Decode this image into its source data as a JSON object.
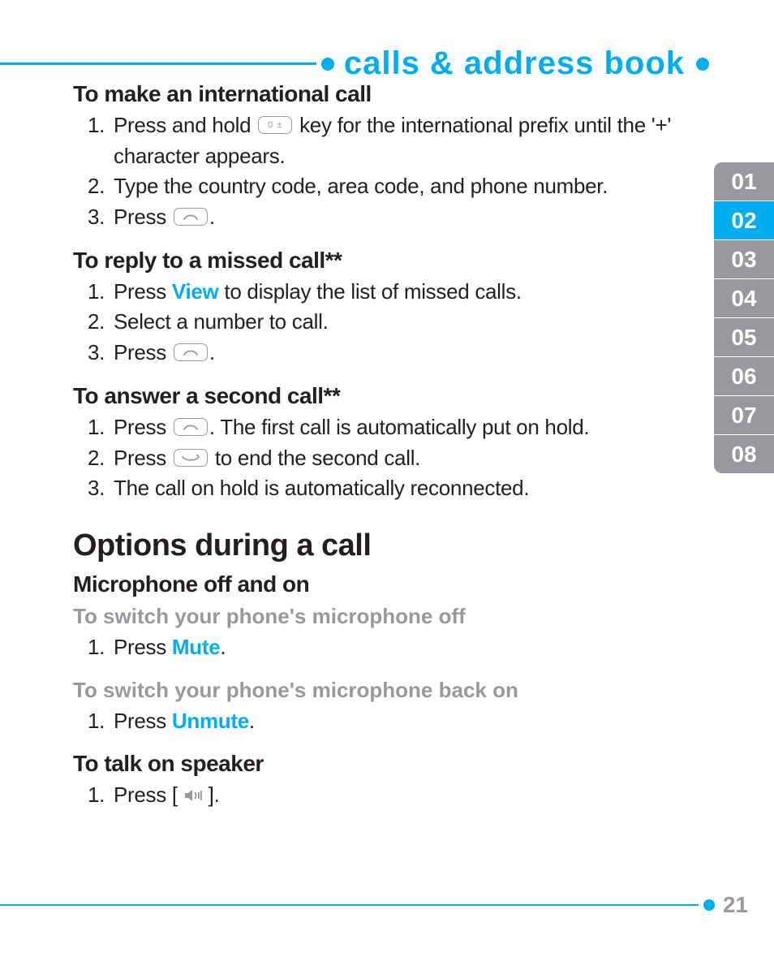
{
  "header": {
    "title": "calls & address book"
  },
  "tabs": [
    "01",
    "02",
    "03",
    "04",
    "05",
    "06",
    "07",
    "08"
  ],
  "active_tab_index": 1,
  "colors": {
    "accent": "#00aeef",
    "muted": "#97999c"
  },
  "page_number": "21",
  "sections": {
    "intl": {
      "title": "To make an international call",
      "steps": {
        "s1a": "Press and hold ",
        "s1_icon": "zero-key-icon",
        "s1b": " key for the international prefix until the '+' character appears.",
        "s2": "Type the country code, area code, and phone number.",
        "s3a": "Press ",
        "s3_icon": "call-key-icon",
        "s3b": "."
      }
    },
    "missed": {
      "title": "To reply to a missed call**",
      "steps": {
        "s1a": "Press ",
        "s1_accent": "View",
        "s1b": " to display the list of missed calls.",
        "s2": "Select a number to call.",
        "s3a": "Press ",
        "s3_icon": "call-key-icon",
        "s3b": "."
      }
    },
    "second": {
      "title": "To answer a second call**",
      "steps": {
        "s1a": "Press ",
        "s1_icon": "call-key-icon",
        "s1b": ". The first call is automatically put on hold.",
        "s2a": "Press ",
        "s2_icon": "end-key-icon",
        "s2b": " to end the second call.",
        "s3": "The call on hold is automatically reconnected."
      }
    },
    "options_heading": "Options during a call",
    "mic": {
      "title": "Microphone off and on",
      "off": {
        "title": "To switch your phone's microphone off",
        "s1a": "Press ",
        "s1_accent": "Mute",
        "s1b": "."
      },
      "on": {
        "title": "To switch your phone's microphone back on",
        "s1a": "Press ",
        "s1_accent": "Unmute",
        "s1b": "."
      }
    },
    "speaker": {
      "title": "To talk on speaker",
      "s1a": "Press [ ",
      "s1_icon": "speaker-icon",
      "s1b": " ]."
    }
  }
}
